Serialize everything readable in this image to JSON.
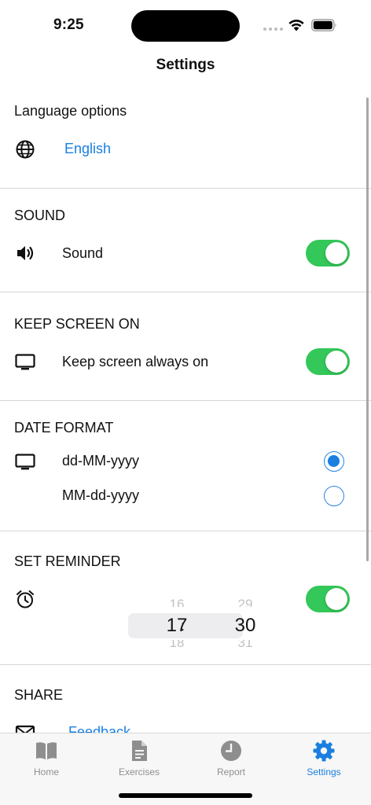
{
  "status": {
    "time": "9:25"
  },
  "header": {
    "title": "Settings"
  },
  "language": {
    "title": "Language options",
    "value": "English"
  },
  "sound": {
    "title": "SOUND",
    "label": "Sound",
    "enabled": true
  },
  "keep_screen": {
    "title": "KEEP SCREEN ON",
    "label": "Keep screen always on",
    "enabled": true
  },
  "date_format": {
    "title": "DATE FORMAT",
    "options": [
      {
        "label": "dd-MM-yyyy",
        "selected": true
      },
      {
        "label": "MM-dd-yyyy",
        "selected": false
      }
    ]
  },
  "reminder": {
    "title": "SET REMINDER",
    "enabled": true,
    "hour": {
      "prev": "16",
      "current": "17",
      "next": "18"
    },
    "minute": {
      "prev": "29",
      "current": "30",
      "next": "31"
    },
    "separator": ":"
  },
  "share": {
    "title": "SHARE",
    "feedback": "Feedback"
  },
  "tabs": [
    {
      "label": "Home",
      "icon": "book-icon",
      "active": false
    },
    {
      "label": "Exercises",
      "icon": "document-icon",
      "active": false
    },
    {
      "label": "Report",
      "icon": "clock-icon",
      "active": false
    },
    {
      "label": "Settings",
      "icon": "gear-icon",
      "active": true
    }
  ],
  "colors": {
    "accent": "#1a7fe0",
    "toggle_on": "#34c759",
    "divider": "#d6d6d6"
  }
}
